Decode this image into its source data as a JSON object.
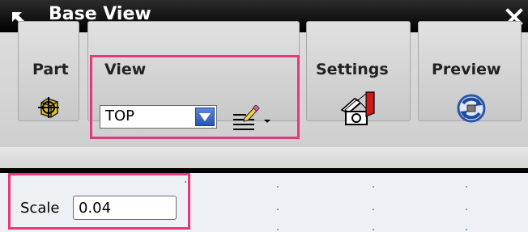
{
  "window": {
    "title": "Base View"
  },
  "toolbar": {
    "groups": [
      {
        "label": "Part"
      },
      {
        "label": "View"
      },
      {
        "label": "Settings"
      },
      {
        "label": "Preview"
      }
    ],
    "view_select": {
      "value": "TOP"
    }
  },
  "scale": {
    "label": "Scale",
    "value": "0.04"
  },
  "colors": {
    "highlight": "#e8367b",
    "titlebar": "#000000",
    "dropdown_button": "#2a55b0"
  },
  "icons": [
    "pin-arrow-icon",
    "close-icon",
    "part-select-icon",
    "dropdown-arrow-icon",
    "edit-style-icon",
    "settings-icon",
    "preview-refresh-icon"
  ]
}
